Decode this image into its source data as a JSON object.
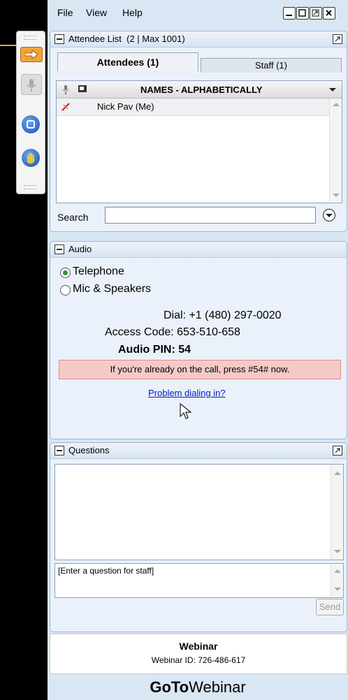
{
  "menu": {
    "file": "File",
    "view": "View",
    "help": "Help"
  },
  "attendee_panel": {
    "title": "Attendee List",
    "count": "(2 | Max 1001)",
    "tabs": [
      {
        "label": "Attendees (1)"
      },
      {
        "label": "Staff (1)"
      }
    ],
    "column_header": "NAMES - ALPHABETICALLY",
    "attendees": [
      {
        "name": "Nick Pav (Me)"
      }
    ],
    "search_label": "Search",
    "search_value": ""
  },
  "audio": {
    "title": "Audio",
    "options": [
      {
        "label": "Telephone",
        "selected": true
      },
      {
        "label": "Mic & Speakers",
        "selected": false
      }
    ],
    "dial": "Dial: +1 (480) 297-0020",
    "access_code": "Access Code: 653-510-658",
    "audio_pin": "Audio PIN: 54",
    "notice": "If you're already on the call, press #54# now.",
    "problem_link": "Problem dialing in?"
  },
  "questions": {
    "title": "Questions",
    "placeholder": "[Enter a question for staff]",
    "send_label": "Send"
  },
  "footer": {
    "title": "Webinar",
    "webinar_id": "Webinar ID: 726-486-617",
    "brand_bold": "GoTo",
    "brand_light": "Webinar"
  },
  "colors": {
    "accent": "#f0a437",
    "panel_bg": "#d9e6f4",
    "alert_bg": "#f6c9c9",
    "link": "#0018c8"
  }
}
